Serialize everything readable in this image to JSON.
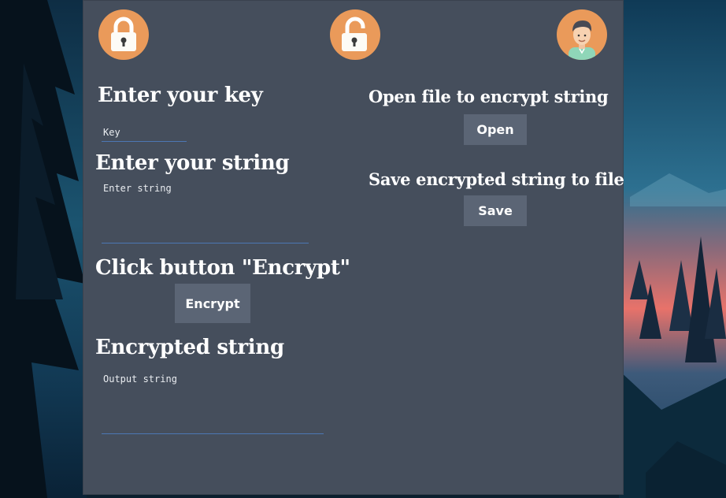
{
  "colors": {
    "panel": "#454e5c",
    "button": "#5b6575",
    "icon_badge": "#ea9a5a",
    "underline": "#4c77b4",
    "text": "#ffffff"
  },
  "icons": {
    "locked": "lock-closed-icon",
    "unlocked": "lock-open-icon",
    "user": "user-avatar-icon"
  },
  "encrypt_panel": {
    "key_heading": "Enter your key",
    "key_placeholder": "Key",
    "key_value": "",
    "string_heading": "Enter your string",
    "string_placeholder": "Enter string",
    "string_value": "",
    "encrypt_heading": "Click button \"Encrypt\"",
    "encrypt_button": "Encrypt",
    "output_heading": "Encrypted string",
    "output_placeholder": "Output string",
    "output_value": ""
  },
  "file_panel": {
    "open_heading": "Open file to encrypt string",
    "open_button": "Open",
    "save_heading": "Save encrypted string to file",
    "save_button": "Save"
  }
}
